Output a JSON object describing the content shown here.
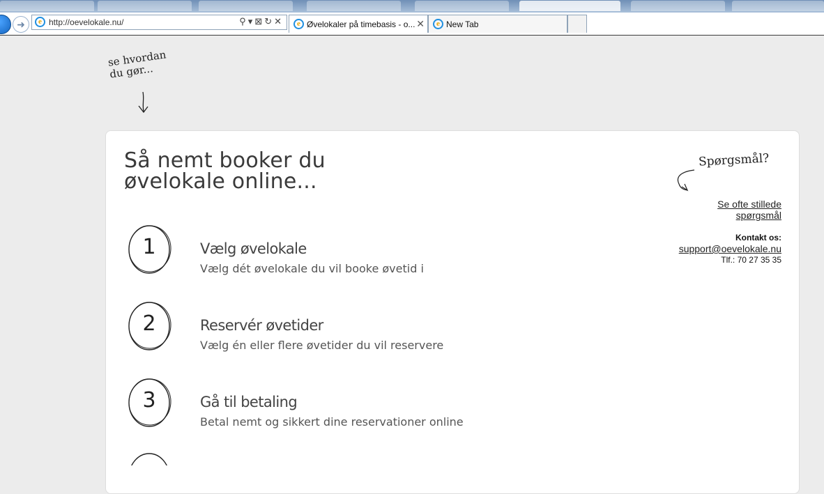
{
  "browser": {
    "address": "http://oevelokale.nu/",
    "tabs": [
      {
        "label": "Øvelokaler på timebasis - o...",
        "close": "✕"
      },
      {
        "label": "New Tab"
      }
    ],
    "buttons": [
      "⚲",
      "▾",
      "⊠",
      "↻",
      "✕"
    ]
  },
  "page": {
    "hint": {
      "line1": "se hvordan",
      "line2": "du gør..."
    },
    "title": {
      "line1": "Så nemt booker du",
      "line2": "øvelokale online..."
    },
    "steps": [
      {
        "num": "1",
        "title": "Vælg øvelokale",
        "desc": "Vælg dét øvelokale du vil booke øvetid i"
      },
      {
        "num": "2",
        "title": "Reservér øvetider",
        "desc": "Vælg én eller flere øvetider du vil reservere"
      },
      {
        "num": "3",
        "title": "Gå til betaling",
        "desc": "Betal nemt og sikkert dine reservationer online"
      }
    ],
    "faq": {
      "heading": "Spørgsmål?",
      "link_line1": "Se ofte stillede",
      "link_line2": "spørgsmål"
    },
    "contact": {
      "label": "Kontakt os:",
      "email": "support@oevelokale.nu",
      "phone": "Tlf.: 70 27 35 35"
    }
  },
  "colors": {
    "page_bg": "#ececec",
    "card_bg": "#ffffff",
    "ie_blue": "#1f8fe0"
  },
  "icons": [
    "back-arrow-icon",
    "forward-arrow-icon",
    "ie-logo-icon",
    "search-icon",
    "refresh-icon",
    "close-icon",
    "hand-drawn-arrow-icon"
  ]
}
